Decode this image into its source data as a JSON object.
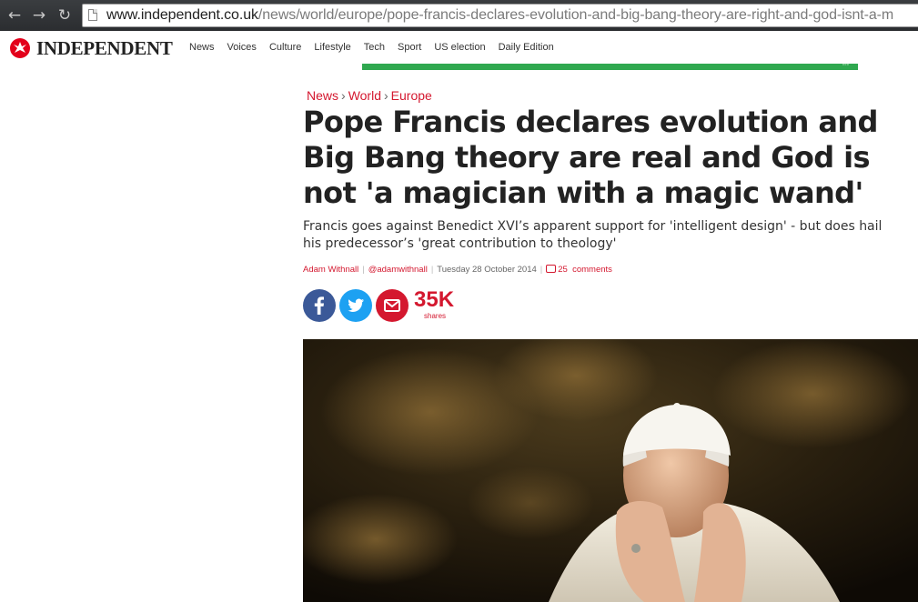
{
  "browser": {
    "url_host": "www.independent.co.uk",
    "url_path": "/news/world/europe/pope-francis-declares-evolution-and-big-bang-theory-are-right-and-god-isnt-a-m"
  },
  "site": {
    "logo_text": "INDEPENDENT",
    "nav": [
      "News",
      "Voices",
      "Culture",
      "Lifestyle",
      "Tech",
      "Sport",
      "US election",
      "Daily Edition"
    ]
  },
  "article": {
    "breadcrumb": [
      "News",
      "World",
      "Europe"
    ],
    "headline": "Pope Francis declares evolution and Big Bang theory are real and God is not 'a magician with a magic wand'",
    "standfirst": "Francis goes against Benedict XVI’s apparent support for 'intelligent design' - but does hail his predecessor’s 'great contribution to theology'",
    "author": "Adam Withnall",
    "twitter": "@adamwithnall",
    "date": "Tuesday 28 October 2014",
    "comments_count": "25",
    "comments_label": "comments",
    "shares_count": "35K",
    "shares_label": "shares"
  },
  "colors": {
    "brand_red": "#d4182f",
    "facebook": "#3b5998",
    "twitter": "#1da1f2",
    "ad_green": "#2fa84f"
  }
}
